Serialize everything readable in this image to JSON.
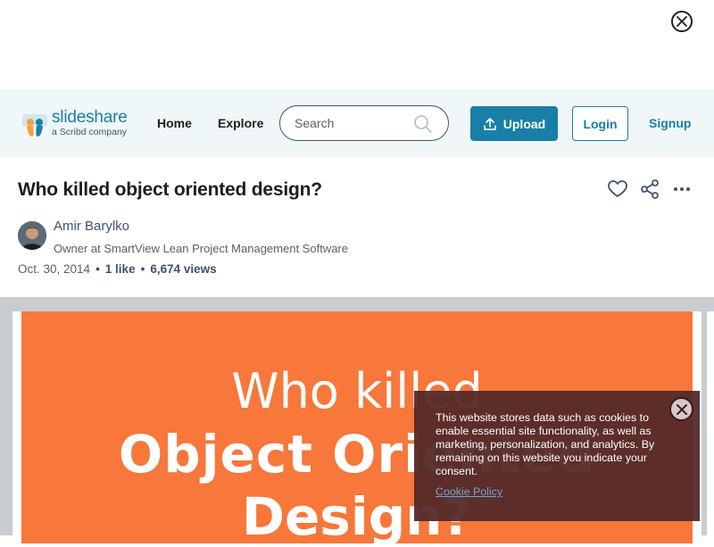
{
  "overlay_close_icon": "close-icon",
  "header": {
    "logo_text": "slideshare",
    "logo_subtext": "a Scribd company",
    "nav": {
      "home": "Home",
      "explore": "Explore"
    },
    "search": {
      "placeholder": "Search",
      "icon": "search-icon"
    },
    "upload_label": "Upload",
    "login_label": "Login",
    "signup_label": "Signup",
    "accent_color": "#1a7fa6"
  },
  "document": {
    "title": "Who killed object oriented design?",
    "actions": [
      "heart-icon",
      "share-icon",
      "more-icon"
    ],
    "author": {
      "name": "Amir Barylko",
      "role": "Owner at SmartView Lean Project Management Software"
    },
    "date": "Oct. 30, 2014",
    "likes": "1 like",
    "views": "6,674 views"
  },
  "slide": {
    "line1": "Who killed",
    "line2": "Object Oriented",
    "line3": "Design?",
    "background_color": "#f8773a"
  },
  "cookie_banner": {
    "text": "This website stores data such as cookies to enable essential site functionality, as well as marketing, personalization, and analytics. By remaining on this website you indicate your consent.",
    "link_label": "Cookie Policy",
    "close_icon": "close-icon"
  }
}
